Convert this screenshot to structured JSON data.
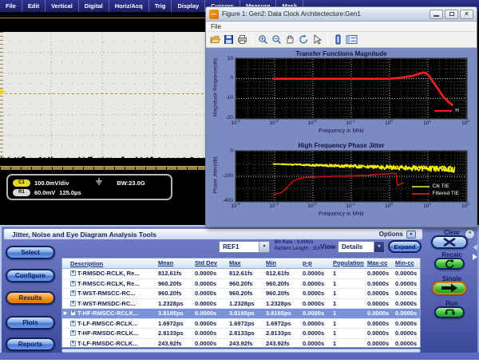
{
  "menu_bar": {
    "items": [
      "File",
      "Edit",
      "Vertical",
      "Digital",
      "Horiz/Acq",
      "Trig",
      "Display",
      "Cursors",
      "Measure",
      "Mask"
    ]
  },
  "scope_display": {
    "readout": {
      "ch1_badge": "C1",
      "ch1_scale": "100.0mV/div",
      "bandwidth": "BW:23.0G",
      "ref_badge": "R1",
      "ref_scale": "60.0mV",
      "ref_timebase": "125.0µs"
    }
  },
  "figure_window": {
    "title": "Figure 1: Gen2: Data Clock Architectecture:Gen1",
    "menu_items": [
      "File"
    ],
    "toolbar_icons": [
      "open-icon",
      "save-icon",
      "print-icon",
      "zoom-in-icon",
      "zoom-out-icon",
      "pan-icon",
      "rotate-icon",
      "data-cursor-icon",
      "colorbar-icon",
      "legend-icon"
    ],
    "window_buttons": [
      "minimize",
      "restore",
      "close"
    ]
  },
  "chart_data": [
    {
      "type": "line",
      "title": "Transfer Functions Magnitude",
      "xlabel": "Frequency in MHz",
      "ylabel": "Magnitude Response(db)",
      "x_scale": "log",
      "xlim": [
        0.0001,
        100
      ],
      "ylim": [
        -20,
        10
      ],
      "yticks": [
        10,
        0,
        -10,
        -20
      ],
      "x_tick_exponents": [
        -4,
        -3,
        -2,
        -1,
        0,
        1,
        2
      ],
      "grid": true,
      "legend_position": "bottom-right",
      "series": [
        {
          "name": "H",
          "color": "#ff1e1e",
          "legend_color": "#ff1e1e",
          "width": 2.6,
          "points": [
            [
              0.0009,
              0
            ],
            [
              0.01,
              0
            ],
            [
              0.1,
              0
            ],
            [
              1,
              0
            ],
            [
              2,
              0.5
            ],
            [
              4,
              1.5
            ],
            [
              6,
              2.6
            ],
            [
              8,
              3.2
            ],
            [
              10,
              2.2
            ],
            [
              13,
              -1
            ],
            [
              18,
              -5
            ],
            [
              25,
              -9
            ],
            [
              35,
              -12
            ],
            [
              45,
              -13.5
            ]
          ]
        }
      ]
    },
    {
      "type": "line",
      "title": "High Frequency Phase Jitter",
      "xlabel": "Frequency in MHz",
      "ylabel": "Phase Jitter(db)",
      "x_scale": "log",
      "xlim": [
        0.0001,
        100
      ],
      "ylim": [
        -400,
        0
      ],
      "yticks": [
        0,
        -200,
        -400
      ],
      "x_tick_exponents": [
        -4,
        -3,
        -2,
        -1,
        0,
        1,
        2
      ],
      "grid": true,
      "legend_position": "bottom-right",
      "series": [
        {
          "name": "Clk TIE",
          "color": "#f2ee00",
          "legend_color": "#b8b430",
          "width": 1.5,
          "noise": [
            3,
            26
          ],
          "points": [
            [
              0.0009,
              -100
            ],
            [
              0.01,
              -110
            ],
            [
              0.1,
              -118
            ],
            [
              1,
              -128
            ],
            [
              10,
              -138
            ],
            [
              50,
              -144
            ]
          ]
        },
        {
          "name": "Filtered TIE",
          "color": "#cc1111",
          "legend_color": "#cc1111",
          "width": 1.4,
          "noise": [
            2,
            4
          ],
          "points": [
            [
              0.0009,
              -350
            ],
            [
              0.0015,
              -330
            ],
            [
              0.002,
              -300
            ],
            [
              0.0025,
              -265
            ],
            [
              0.003,
              -240
            ],
            [
              0.004,
              -222
            ],
            [
              0.006,
              -212
            ],
            [
              0.01,
              -206
            ],
            [
              0.03,
              -200
            ],
            [
              0.1,
              -196
            ],
            [
              0.3,
              -190
            ],
            [
              0.6,
              -183
            ],
            [
              1.0,
              -178
            ],
            [
              1.4,
              -176
            ],
            [
              1.5,
              -180
            ],
            [
              1.55,
              -235
            ],
            [
              1.6,
              -280
            ],
            [
              1.9,
              -262
            ],
            [
              2.3,
              -255
            ]
          ]
        }
      ]
    }
  ],
  "analysis_panel": {
    "title": "Jitter, Noise and Eye Diagram Analysis Tools",
    "options_label": "Options",
    "nav_buttons": [
      {
        "label": "Select",
        "active": false
      },
      {
        "label": "Configure",
        "active": false
      },
      {
        "label": "Results",
        "active": true
      },
      {
        "label": "Plots",
        "active": false
      },
      {
        "label": "Reports",
        "active": false
      }
    ],
    "source_select": "REF1",
    "bit_rate": "Bit Rate :  0.00b/s",
    "pattern_length": "Pattern Length : 2UI",
    "view_label": "View",
    "view_select": "Details",
    "expand_label": "Expand",
    "table": {
      "columns": [
        "Description",
        "Mean",
        "Std Dev",
        "Max",
        "Min",
        "p-p",
        "Population",
        "Max-cc",
        "Min-cc"
      ],
      "rows": [
        {
          "description": "T-RMSDC-RCLK, Re...",
          "mean": "812.61fs",
          "std_dev": "0.0000s",
          "max": "812.61fs",
          "min": "812.61fs",
          "p_p": "0.0000s",
          "population": "1",
          "max_cc": "0.0000s",
          "min_cc": "0.0000s",
          "selected": false
        },
        {
          "description": "T-RMSCC-RCLK, Re...",
          "mean": "960.20fs",
          "std_dev": "0.0000s",
          "max": "960.20fs",
          "min": "960.20fs",
          "p_p": "0.0000s",
          "population": "1",
          "max_cc": "0.0000s",
          "min_cc": "0.0000s",
          "selected": false
        },
        {
          "description": "T-WST-RMSCC-RC...",
          "mean": "960.20fs",
          "std_dev": "0.0000s",
          "max": "960.20fs",
          "min": "960.20fs",
          "p_p": "0.0000s",
          "population": "1",
          "max_cc": "0.0000s",
          "min_cc": "0.0000s",
          "selected": false
        },
        {
          "description": "T-WST-RMSDC-RC...",
          "mean": "1.2328ps",
          "std_dev": "0.0000s",
          "max": "1.2328ps",
          "min": "1.2328ps",
          "p_p": "0.0000s",
          "population": "1",
          "max_cc": "0.0000s",
          "min_cc": "0.0000s",
          "selected": false
        },
        {
          "description": "T-HF-RMSCC-RCLK...",
          "mean": "3.8165ps",
          "std_dev": "0.0000s",
          "max": "3.8165ps",
          "min": "3.8165ps",
          "p_p": "0.0000s",
          "population": "1",
          "max_cc": "0.0000s",
          "min_cc": "0.0000s",
          "selected": true
        },
        {
          "description": "T-LF-RMSCC-RCLK...",
          "mean": "1.6972ps",
          "std_dev": "0.0000s",
          "max": "1.6972ps",
          "min": "1.6972ps",
          "p_p": "0.0000s",
          "population": "1",
          "max_cc": "0.0000s",
          "min_cc": "0.0000s",
          "selected": false
        },
        {
          "description": "T-HF-RMSDC-RCLK...",
          "mean": "2.8133ps",
          "std_dev": "0.0000s",
          "max": "2.8133ps",
          "min": "2.8133ps",
          "p_p": "0.0000s",
          "population": "1",
          "max_cc": "0.0000s",
          "min_cc": "0.0000s",
          "selected": false
        },
        {
          "description": "T-LF-RMSDC-RCLK...",
          "mean": "243.92fs",
          "std_dev": "0.0000s",
          "max": "243.92fs",
          "min": "243.92fs",
          "p_p": "0.0000s",
          "population": "1",
          "max_cc": "0.0000s",
          "min_cc": "0.0000s",
          "selected": false
        }
      ]
    }
  },
  "right_controls": {
    "buttons": [
      {
        "label": "Clear",
        "icon": "clear-x-icon",
        "style": "blue"
      },
      {
        "label": "Recalc",
        "icon": "recalc-icon",
        "style": "green"
      },
      {
        "label": "Single",
        "icon": "single-arrow-icon",
        "style": "green-armed"
      },
      {
        "label": "Run",
        "icon": "run-loop-icon",
        "style": "green"
      }
    ]
  }
}
